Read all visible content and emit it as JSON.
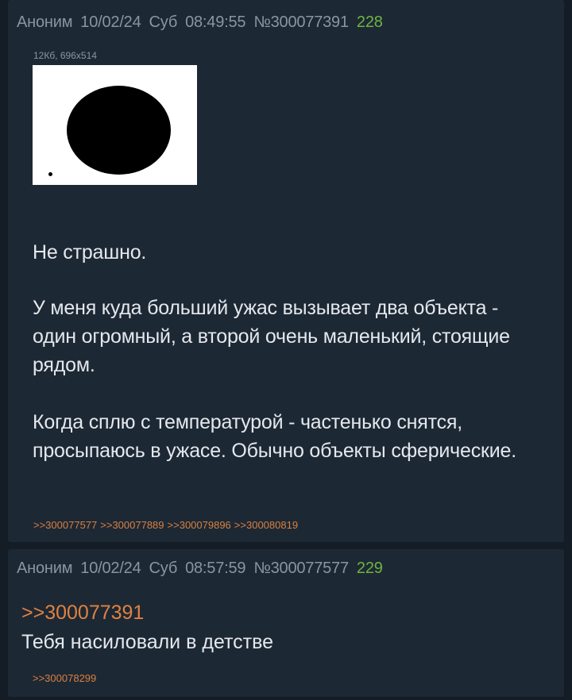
{
  "posts": [
    {
      "author": "Аноним",
      "date": "10/02/24",
      "day": "Суб",
      "time": "08:49:55",
      "number": "№300077391",
      "index": "228",
      "file_info": "12Кб, 696x514",
      "paragraphs": [
        "Не страшно.",
        "У меня куда больший ужас вызывает два объекта - один огромный, а второй очень маленький, стоящие рядом.",
        "Когда сплю с температурой - частенько снятся, просыпаюсь в ужасе. Обычно объекты сферические."
      ],
      "replies": [
        ">>300077577",
        ">>300077889",
        ">>300079896",
        ">>300080819"
      ]
    },
    {
      "author": "Аноним",
      "date": "10/02/24",
      "day": "Суб",
      "time": "08:57:59",
      "number": "№300077577",
      "index": "229",
      "quote": ">>300077391",
      "text": "Тебя насиловали в детстве",
      "replies": [
        ">>300078299"
      ]
    }
  ],
  "colors": {
    "background": "#141c26",
    "post_background": "#1d2835",
    "meta_text": "#8a95a2",
    "post_index": "#6fb43f",
    "link": "#d9803f",
    "body_text": "#e4e8ec"
  }
}
